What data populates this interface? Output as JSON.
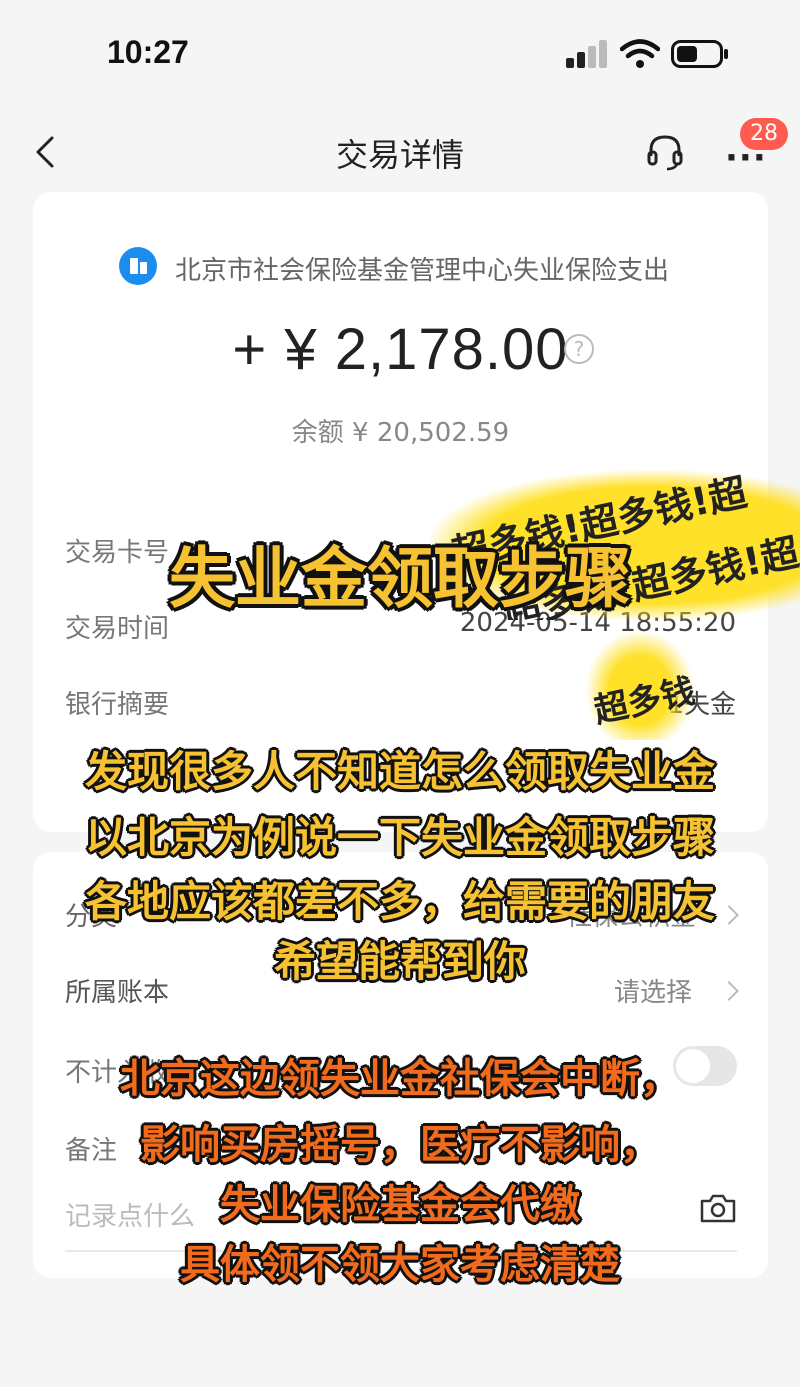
{
  "status_bar": {
    "time": "10:27"
  },
  "nav": {
    "title": "交易详情",
    "badge": "28",
    "more": "···"
  },
  "transaction": {
    "merchant": "北京市社会保险基金管理中心失业保险支出",
    "amount": "+ ¥ 2,178.00",
    "help": "?",
    "balance": "余额 ¥ 20,502.59"
  },
  "details": {
    "card_label": "交易卡号",
    "time_label": "交易时间",
    "time_value": "2024-05-14 18:55:20",
    "summary_label": "银行摘要",
    "summary_value": "01失金"
  },
  "card2": {
    "category_label": "分类",
    "category_value": "社保公积金",
    "account_label": "所属账本",
    "account_value": "请选择",
    "toggle_label": "不计入收支",
    "note_label": "备注",
    "note_placeholder": "记录点什么"
  },
  "sticker": {
    "text": "超多钱!超多钱!超"
  },
  "overlay": {
    "title": "失业金领取步骤",
    "lines_yellow": [
      "发现很多人不知道怎么领取失业金",
      "以北京为例说一下失业金领取步骤",
      "各地应该都差不多，给需要的朋友",
      "希望能帮到你"
    ],
    "lines_orange": [
      "北京这边领失业金社保会中断，",
      "影响买房摇号，医疗不影响，",
      "失业保险基金会代缴",
      "具体领不领大家考虑清楚"
    ]
  },
  "colors": {
    "accent_blue": "#1c8df0",
    "badge_red": "#ff5b4e",
    "overlay_yellow": "#f7c232",
    "overlay_orange": "#f26a1b",
    "sticker_yellow": "#ffe12a"
  }
}
